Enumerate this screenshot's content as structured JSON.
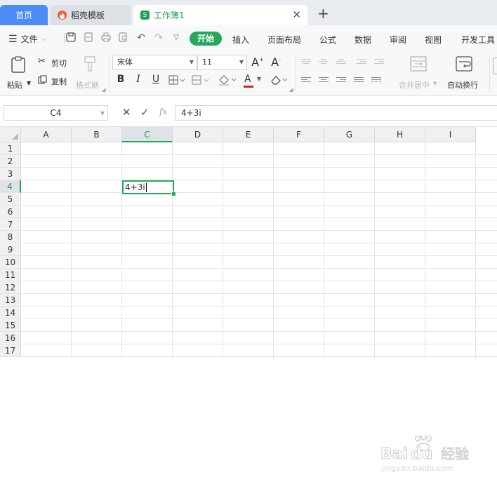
{
  "tabs": {
    "home": "首页",
    "templates": "稻壳模板",
    "workbook": "工作簿1",
    "new_tab": "+"
  },
  "menubar": {
    "file": "文件",
    "items": [
      "开始",
      "插入",
      "页面布局",
      "公式",
      "数据",
      "审阅",
      "视图",
      "开发工具"
    ],
    "active": "开始"
  },
  "ribbon": {
    "paste": "粘贴",
    "cut": "剪切",
    "copy": "复制",
    "format_painter": "格式刷",
    "font_name": "宋体",
    "font_size": "11",
    "bold": "B",
    "italic": "I",
    "underline": "U",
    "font_color_letter": "A",
    "merge_center": "合并居中",
    "wrap_text": "自动换行"
  },
  "formula_bar": {
    "name_box": "C4",
    "fx": "fx",
    "formula": "4+3i"
  },
  "grid": {
    "columns": [
      "A",
      "B",
      "C",
      "D",
      "E",
      "F",
      "G",
      "H",
      "I"
    ],
    "rows": [
      "1",
      "2",
      "3",
      "4",
      "5",
      "6",
      "7",
      "8",
      "9",
      "10",
      "11",
      "12",
      "13",
      "14",
      "15",
      "16",
      "17"
    ],
    "active_column": "C",
    "active_row": "4",
    "active_cell_value": "4+3i"
  },
  "watermark": {
    "brand": "Baidu经验",
    "url": "jingyan.baidu.com"
  },
  "colors": {
    "accent_green": "#26a85a",
    "home_tab_blue": "#4a8bf5",
    "font_color_red": "#e02020"
  }
}
